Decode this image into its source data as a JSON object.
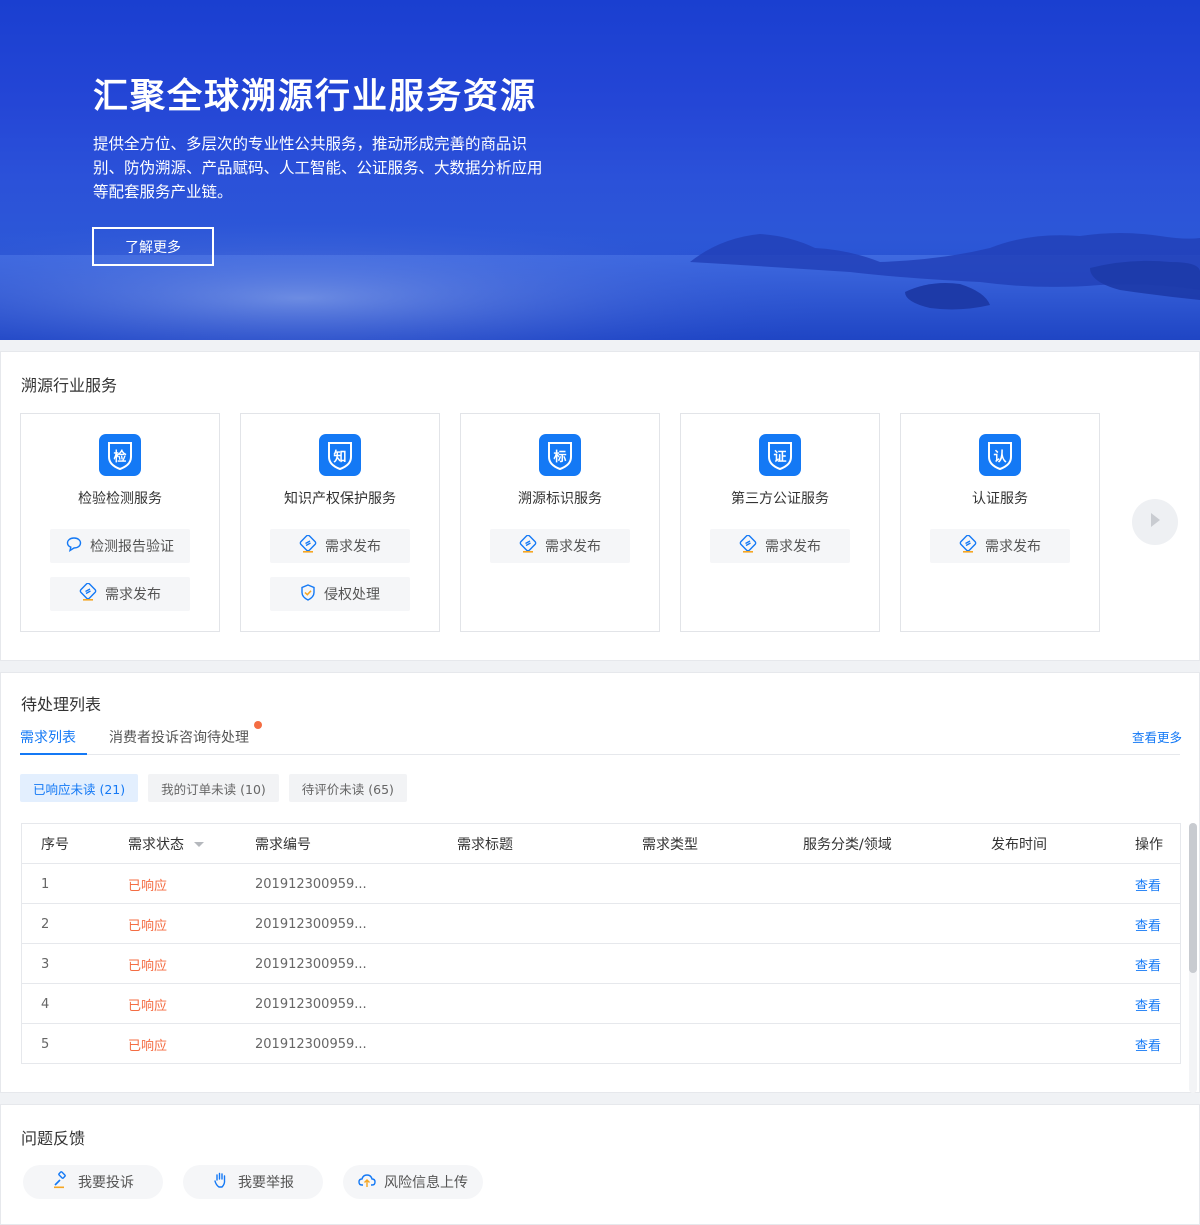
{
  "hero": {
    "title": "汇聚全球溯源行业服务资源",
    "description": "提供全方位、多层次的专业性公共服务，推动形成完善的商品识别、防伪溯源、产品赋码、人工智能、公证服务、大数据分析应用等配套服务产业链。",
    "button_label": "了解更多"
  },
  "services": {
    "title": "溯源行业服务",
    "cards": [
      {
        "badge": "检",
        "name": "检验检测服务",
        "actions": [
          {
            "label": "检测报告验证",
            "icon": "chat-bubble-icon"
          },
          {
            "label": "需求发布",
            "icon": "publish-icon"
          }
        ]
      },
      {
        "badge": "知",
        "name": "知识产权保护服务",
        "actions": [
          {
            "label": "需求发布",
            "icon": "publish-icon"
          },
          {
            "label": "侵权处理",
            "icon": "shield-check-icon"
          }
        ]
      },
      {
        "badge": "标",
        "name": "溯源标识服务",
        "actions": [
          {
            "label": "需求发布",
            "icon": "publish-icon"
          }
        ]
      },
      {
        "badge": "证",
        "name": "第三方公证服务",
        "actions": [
          {
            "label": "需求发布",
            "icon": "publish-icon"
          }
        ]
      },
      {
        "badge": "认",
        "name": "认证服务",
        "actions": [
          {
            "label": "需求发布",
            "icon": "publish-icon"
          }
        ]
      }
    ]
  },
  "pending": {
    "title": "待处理列表",
    "tabs": [
      {
        "label": "需求列表",
        "active": true
      },
      {
        "label": "消费者投诉咨询待处理",
        "active": false
      }
    ],
    "more_label": "查看更多",
    "filters": [
      {
        "label": "已响应未读 (21)",
        "active": true
      },
      {
        "label": "我的订单未读 (10)",
        "active": false
      },
      {
        "label": "待评价未读 (65)",
        "active": false
      }
    ],
    "columns": [
      "序号",
      "需求状态",
      "需求编号",
      "需求标题",
      "需求类型",
      "服务分类/领域",
      "发布时间",
      "操作"
    ],
    "rows": [
      {
        "index": "1",
        "status": "已响应",
        "number": "201912300959...",
        "title": "",
        "type": "",
        "category": "",
        "time": "",
        "action": "查看"
      },
      {
        "index": "2",
        "status": "已响应",
        "number": "201912300959...",
        "title": "",
        "type": "",
        "category": "",
        "time": "",
        "action": "查看"
      },
      {
        "index": "3",
        "status": "已响应",
        "number": "201912300959...",
        "title": "",
        "type": "",
        "category": "",
        "time": "",
        "action": "查看"
      },
      {
        "index": "4",
        "status": "已响应",
        "number": "201912300959...",
        "title": "",
        "type": "",
        "category": "",
        "time": "",
        "action": "查看"
      },
      {
        "index": "5",
        "status": "已响应",
        "number": "201912300959...",
        "title": "",
        "type": "",
        "category": "",
        "time": "",
        "action": "查看"
      }
    ]
  },
  "feedback": {
    "title": "问题反馈",
    "buttons": [
      {
        "label": "我要投诉",
        "icon": "gavel-icon"
      },
      {
        "label": "我要举报",
        "icon": "hand-icon"
      },
      {
        "label": "风险信息上传",
        "icon": "cloud-upload-icon"
      }
    ]
  },
  "colors": {
    "primary": "#1479f5",
    "status_responded": "#f46d43",
    "hero_blue": "#2446d6"
  }
}
